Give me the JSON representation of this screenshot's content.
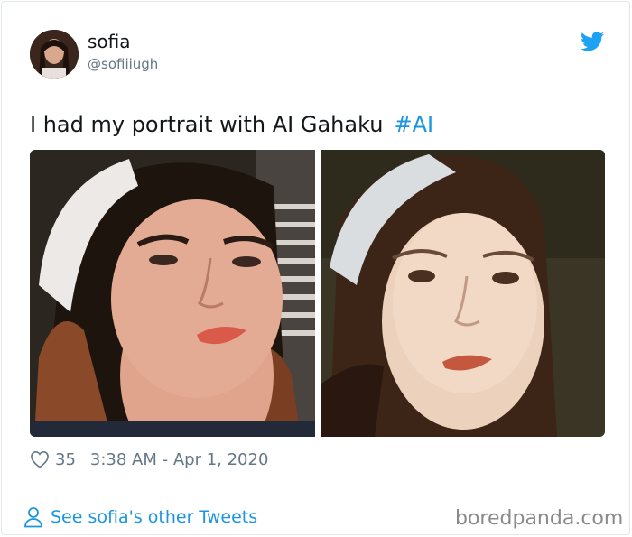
{
  "author": {
    "display_name": "sofia",
    "handle": "@sofiiiugh"
  },
  "tweet": {
    "text": "I had my portrait with AI Gahaku",
    "hashtag": "#AI"
  },
  "meta": {
    "like_count": "35",
    "timestamp": "3:38 AM - Apr 1, 2020"
  },
  "footer": {
    "see_tweets_label": "See sofia's other Tweets",
    "watermark": "boredpanda.com"
  },
  "icons": {
    "brand": "twitter-bird-icon",
    "like": "heart-icon",
    "profile": "person-icon"
  },
  "colors": {
    "link": "#1b95e0",
    "muted": "#657786",
    "twitter_blue": "#1da1f2"
  }
}
